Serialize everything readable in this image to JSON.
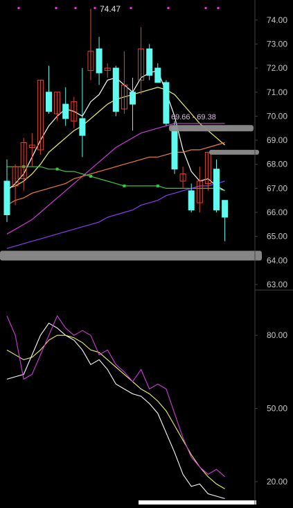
{
  "colors": {
    "background": "#000000",
    "axis_line": "#444444",
    "axis_text": "#c8c8c8",
    "up_candle": "#e2462f",
    "down_candle": "#5ffbf1",
    "ma_white": "#ffffff",
    "ma_yellow": "#f3f36c",
    "ma_magenta": "#d23cdc",
    "ma_orange": "#f08232",
    "ma_green": "#3cc83c",
    "ma_purple": "#8c3cf0",
    "kdj_k": "#ffffff",
    "kdj_d": "#f3f36c",
    "kdj_j": "#d23cdc",
    "marker": "#dd3cdd"
  },
  "annotations": {
    "high_label": "74.47",
    "range_label": "69.66 - 69.38"
  },
  "chart_data": [
    {
      "type": "candlestick",
      "title": "",
      "ylim": [
        63.0,
        74.6
      ],
      "y_ticks": [
        "74.00",
        "73.00",
        "72.00",
        "71.00",
        "70.00",
        "69.00",
        "68.00",
        "67.00",
        "66.00",
        "65.00",
        "64.00",
        "63.00"
      ],
      "grid": false,
      "candles": [
        {
          "o": 67.3,
          "h": 68.2,
          "l": 65.6,
          "c": 65.9
        },
        {
          "o": 67.1,
          "h": 68.0,
          "l": 66.3,
          "c": 67.9
        },
        {
          "o": 67.4,
          "h": 69.1,
          "l": 66.9,
          "c": 68.9
        },
        {
          "o": 68.7,
          "h": 69.3,
          "l": 67.9,
          "c": 68.8
        },
        {
          "o": 68.6,
          "h": 71.5,
          "l": 68.4,
          "c": 71.5
        },
        {
          "o": 71.0,
          "h": 72.1,
          "l": 70.1,
          "c": 70.2
        },
        {
          "o": 70.1,
          "h": 71.0,
          "l": 69.8,
          "c": 71.0
        },
        {
          "o": 70.5,
          "h": 71.2,
          "l": 69.6,
          "c": 69.9
        },
        {
          "o": 69.8,
          "h": 70.8,
          "l": 69.5,
          "c": 70.6
        },
        {
          "o": 69.9,
          "h": 72.0,
          "l": 68.3,
          "c": 69.2
        },
        {
          "o": 71.9,
          "h": 74.47,
          "l": 71.5,
          "c": 72.7
        },
        {
          "o": 72.8,
          "h": 73.3,
          "l": 71.3,
          "c": 71.8
        },
        {
          "o": 71.9,
          "h": 72.2,
          "l": 71.6,
          "c": 72.0
        },
        {
          "o": 72.0,
          "h": 72.1,
          "l": 70.0,
          "c": 70.2
        },
        {
          "o": 70.3,
          "h": 72.7,
          "l": 70.1,
          "c": 71.3
        },
        {
          "o": 71.0,
          "h": 71.6,
          "l": 69.4,
          "c": 70.5
        },
        {
          "o": 71.5,
          "h": 73.7,
          "l": 70.9,
          "c": 72.8
        },
        {
          "o": 72.8,
          "h": 73.0,
          "l": 71.5,
          "c": 71.7
        },
        {
          "o": 72.0,
          "h": 72.2,
          "l": 71.4,
          "c": 71.4
        },
        {
          "o": 71.4,
          "h": 71.5,
          "l": 69.6,
          "c": 69.7
        },
        {
          "o": 69.6,
          "h": 69.8,
          "l": 67.6,
          "c": 67.8
        },
        {
          "o": 67.3,
          "h": 67.9,
          "l": 67.0,
          "c": 67.6
        },
        {
          "o": 66.9,
          "h": 67.2,
          "l": 66.0,
          "c": 66.1
        },
        {
          "o": 66.4,
          "h": 67.9,
          "l": 66.0,
          "c": 67.3
        },
        {
          "o": 67.2,
          "h": 68.5,
          "l": 66.9,
          "c": 68.5
        },
        {
          "o": 67.8,
          "h": 68.2,
          "l": 66.0,
          "c": 66.1
        },
        {
          "o": 66.5,
          "h": 66.5,
          "l": 64.8,
          "c": 65.8
        }
      ],
      "moving_averages": [
        {
          "color_key": "ma_white",
          "values": [
            66.9,
            67.2,
            67.6,
            68.3,
            69.0,
            69.6,
            70.0,
            70.3,
            70.2,
            70.0,
            70.6,
            70.9,
            71.5,
            71.6,
            71.3,
            71.0,
            71.6,
            71.8,
            71.9,
            71.0,
            70.0,
            68.6,
            67.7,
            67.3,
            67.4,
            67.1,
            66.9
          ]
        },
        {
          "color_key": "ma_yellow",
          "values": [
            67.0,
            67.1,
            67.3,
            67.6,
            68.0,
            68.5,
            68.8,
            69.1,
            69.4,
            69.6,
            69.9,
            70.2,
            70.5,
            70.7,
            70.8,
            70.9,
            71.0,
            71.1,
            71.2,
            71.1,
            70.9,
            70.5,
            70.1,
            69.7,
            69.4,
            69.1,
            68.8
          ]
        },
        {
          "color_key": "ma_magenta",
          "values": [
            65.1,
            65.3,
            65.5,
            65.7,
            66.0,
            66.3,
            66.6,
            66.9,
            67.2,
            67.5,
            67.8,
            68.1,
            68.4,
            68.7,
            68.9,
            69.1,
            69.3,
            69.4,
            69.5,
            69.6,
            69.7,
            69.7,
            69.7,
            69.7,
            69.7,
            69.7,
            69.7
          ]
        },
        {
          "color_key": "ma_orange",
          "values": [
            66.3,
            66.5,
            66.6,
            66.8,
            66.9,
            67.0,
            67.1,
            67.2,
            67.4,
            67.5,
            67.6,
            67.7,
            67.8,
            67.9,
            68.0,
            68.1,
            68.2,
            68.3,
            68.3,
            68.4,
            68.5,
            68.5,
            68.6,
            68.6,
            68.7,
            68.8,
            68.9
          ]
        },
        {
          "color_key": "ma_green",
          "values": [
            67.9,
            67.9,
            67.9,
            67.9,
            67.9,
            67.8,
            67.8,
            67.7,
            67.7,
            67.6,
            67.5,
            67.4,
            67.3,
            67.2,
            67.1,
            67.1,
            67.1,
            67.1,
            67.1,
            67.0,
            67.0,
            67.0,
            67.0,
            67.0,
            67.0,
            67.0,
            66.9
          ]
        },
        {
          "color_key": "ma_purple",
          "values": [
            64.5,
            64.6,
            64.7,
            64.8,
            64.9,
            65.0,
            65.1,
            65.2,
            65.3,
            65.4,
            65.5,
            65.6,
            65.8,
            65.9,
            66.0,
            66.1,
            66.3,
            66.4,
            66.5,
            66.7,
            66.8,
            66.9,
            67.0,
            67.1,
            67.1,
            67.2,
            67.3
          ]
        }
      ],
      "level_bars": [
        {
          "y": 69.5
        },
        {
          "y": 68.5
        },
        {
          "y": 64.2
        }
      ]
    },
    {
      "type": "line",
      "title": "",
      "ylim": [
        12.0,
        98.0
      ],
      "y_ticks": [
        "80.00",
        "50.00",
        "20.00"
      ],
      "grid": false,
      "series": [
        {
          "color_key": "kdj_k",
          "values": [
            62,
            63,
            64,
            72,
            80,
            85,
            83,
            80,
            78,
            74,
            68,
            70,
            66,
            60,
            58,
            56,
            55,
            52,
            48,
            40,
            32,
            23,
            18,
            19,
            15,
            14,
            13
          ]
        },
        {
          "color_key": "kdj_d",
          "values": [
            74,
            72,
            70,
            71,
            74,
            78,
            80,
            80,
            79,
            77,
            74,
            73,
            70,
            67,
            64,
            61,
            58,
            56,
            53,
            49,
            43,
            37,
            31,
            26,
            22,
            19,
            17
          ]
        },
        {
          "color_key": "kdj_j",
          "values": [
            88,
            80,
            62,
            64,
            72,
            80,
            88,
            83,
            80,
            82,
            80,
            72,
            74,
            68,
            65,
            61,
            66,
            58,
            60,
            58,
            48,
            38,
            30,
            26,
            23,
            25,
            22
          ]
        }
      ]
    }
  ]
}
